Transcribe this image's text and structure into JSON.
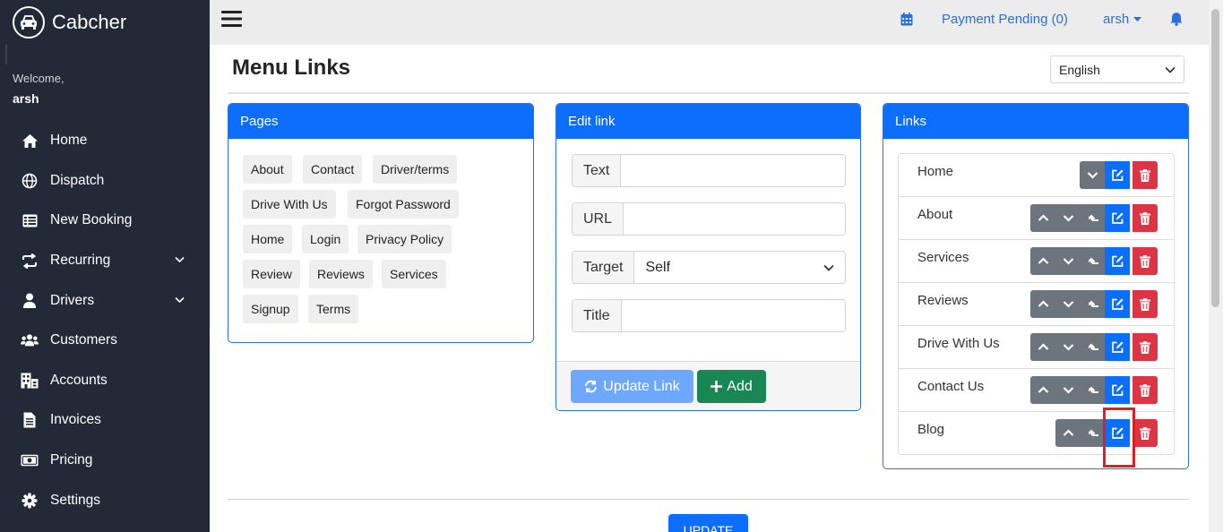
{
  "sidebar": {
    "brand": "Cabcher",
    "welcome": "Welcome,",
    "user": "arsh",
    "items": [
      {
        "label": "Home",
        "icon": "home-icon"
      },
      {
        "label": "Dispatch",
        "icon": "globe-icon"
      },
      {
        "label": "New Booking",
        "icon": "table-icon"
      },
      {
        "label": "Recurring",
        "icon": "repeat-icon",
        "expandable": true
      },
      {
        "label": "Drivers",
        "icon": "user-icon",
        "expandable": true
      },
      {
        "label": "Customers",
        "icon": "users-icon"
      },
      {
        "label": "Accounts",
        "icon": "building-icon"
      },
      {
        "label": "Invoices",
        "icon": "file-icon"
      },
      {
        "label": "Pricing",
        "icon": "money-icon"
      },
      {
        "label": "Settings",
        "icon": "gear-icon"
      }
    ]
  },
  "topbar": {
    "payment": "Payment Pending (0)",
    "user": "arsh"
  },
  "main": {
    "title": "Menu Links",
    "language": "English",
    "pages_card": {
      "title": "Pages",
      "chips": [
        "About",
        "Contact",
        "Driver/terms",
        "Drive With Us",
        "Forgot Password",
        "Home",
        "Login",
        "Privacy Policy",
        "Review",
        "Reviews",
        "Services",
        "Signup",
        "Terms"
      ]
    },
    "edit_card": {
      "title": "Edit link",
      "text_label": "Text",
      "text_value": "",
      "url_label": "URL",
      "url_value": "",
      "target_label": "Target",
      "target_value": "Self",
      "title_label": "Title",
      "title_value": "",
      "update_button": "Update Link",
      "add_button": "Add"
    },
    "links_card": {
      "title": "Links",
      "links": [
        "Home",
        "About",
        "Services",
        "Reviews",
        "Drive With Us",
        "Contact Us",
        "Blog"
      ]
    },
    "update_button": "UPDATE"
  },
  "colors": {
    "sidebar_bg": "#212a36",
    "primary": "#0d6efd",
    "success": "#198754",
    "danger": "#dc3545",
    "secondary": "#6c757d",
    "highlight": "#dc1f26"
  }
}
